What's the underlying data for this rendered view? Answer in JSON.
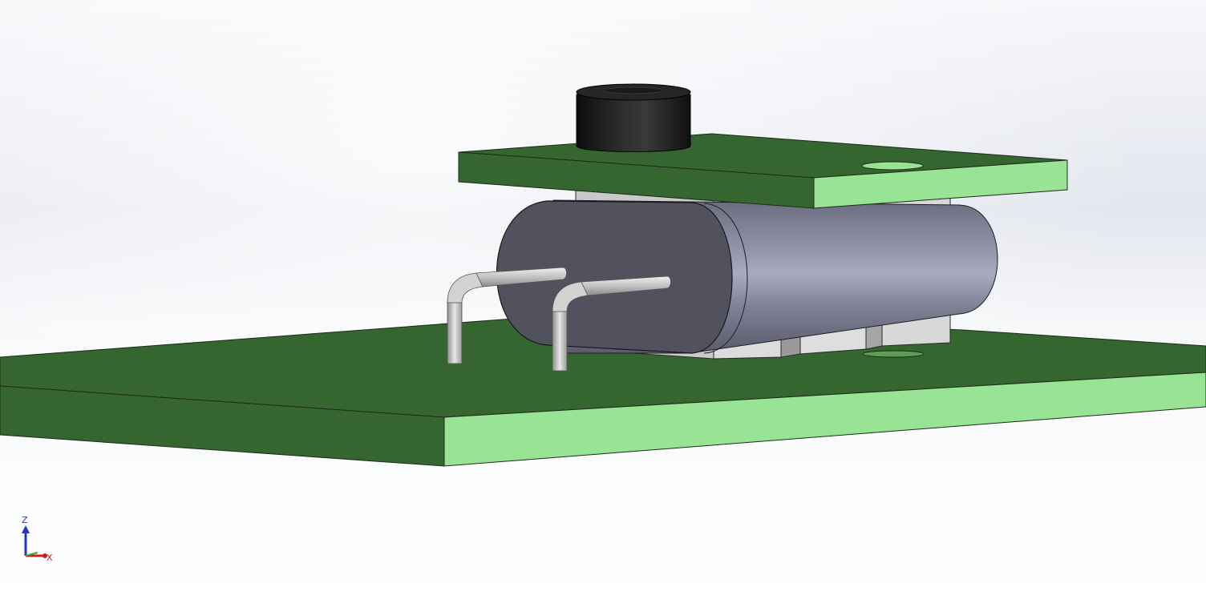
{
  "view": {
    "background_top": "#d8dce6",
    "background_bottom": "#ffffff",
    "board_top_color": "#35662f",
    "board_edge_color": "#98e394",
    "component_body_color": "#7d7f92",
    "component_end_color": "#51525e",
    "button_color": "#151515",
    "pin_color": "#c8c8c8",
    "standoff_color": "#c6c6c6"
  },
  "triad": {
    "z_label": "Z",
    "x_label": "X",
    "z_color": "#1d35c9",
    "x_color": "#c42020"
  }
}
